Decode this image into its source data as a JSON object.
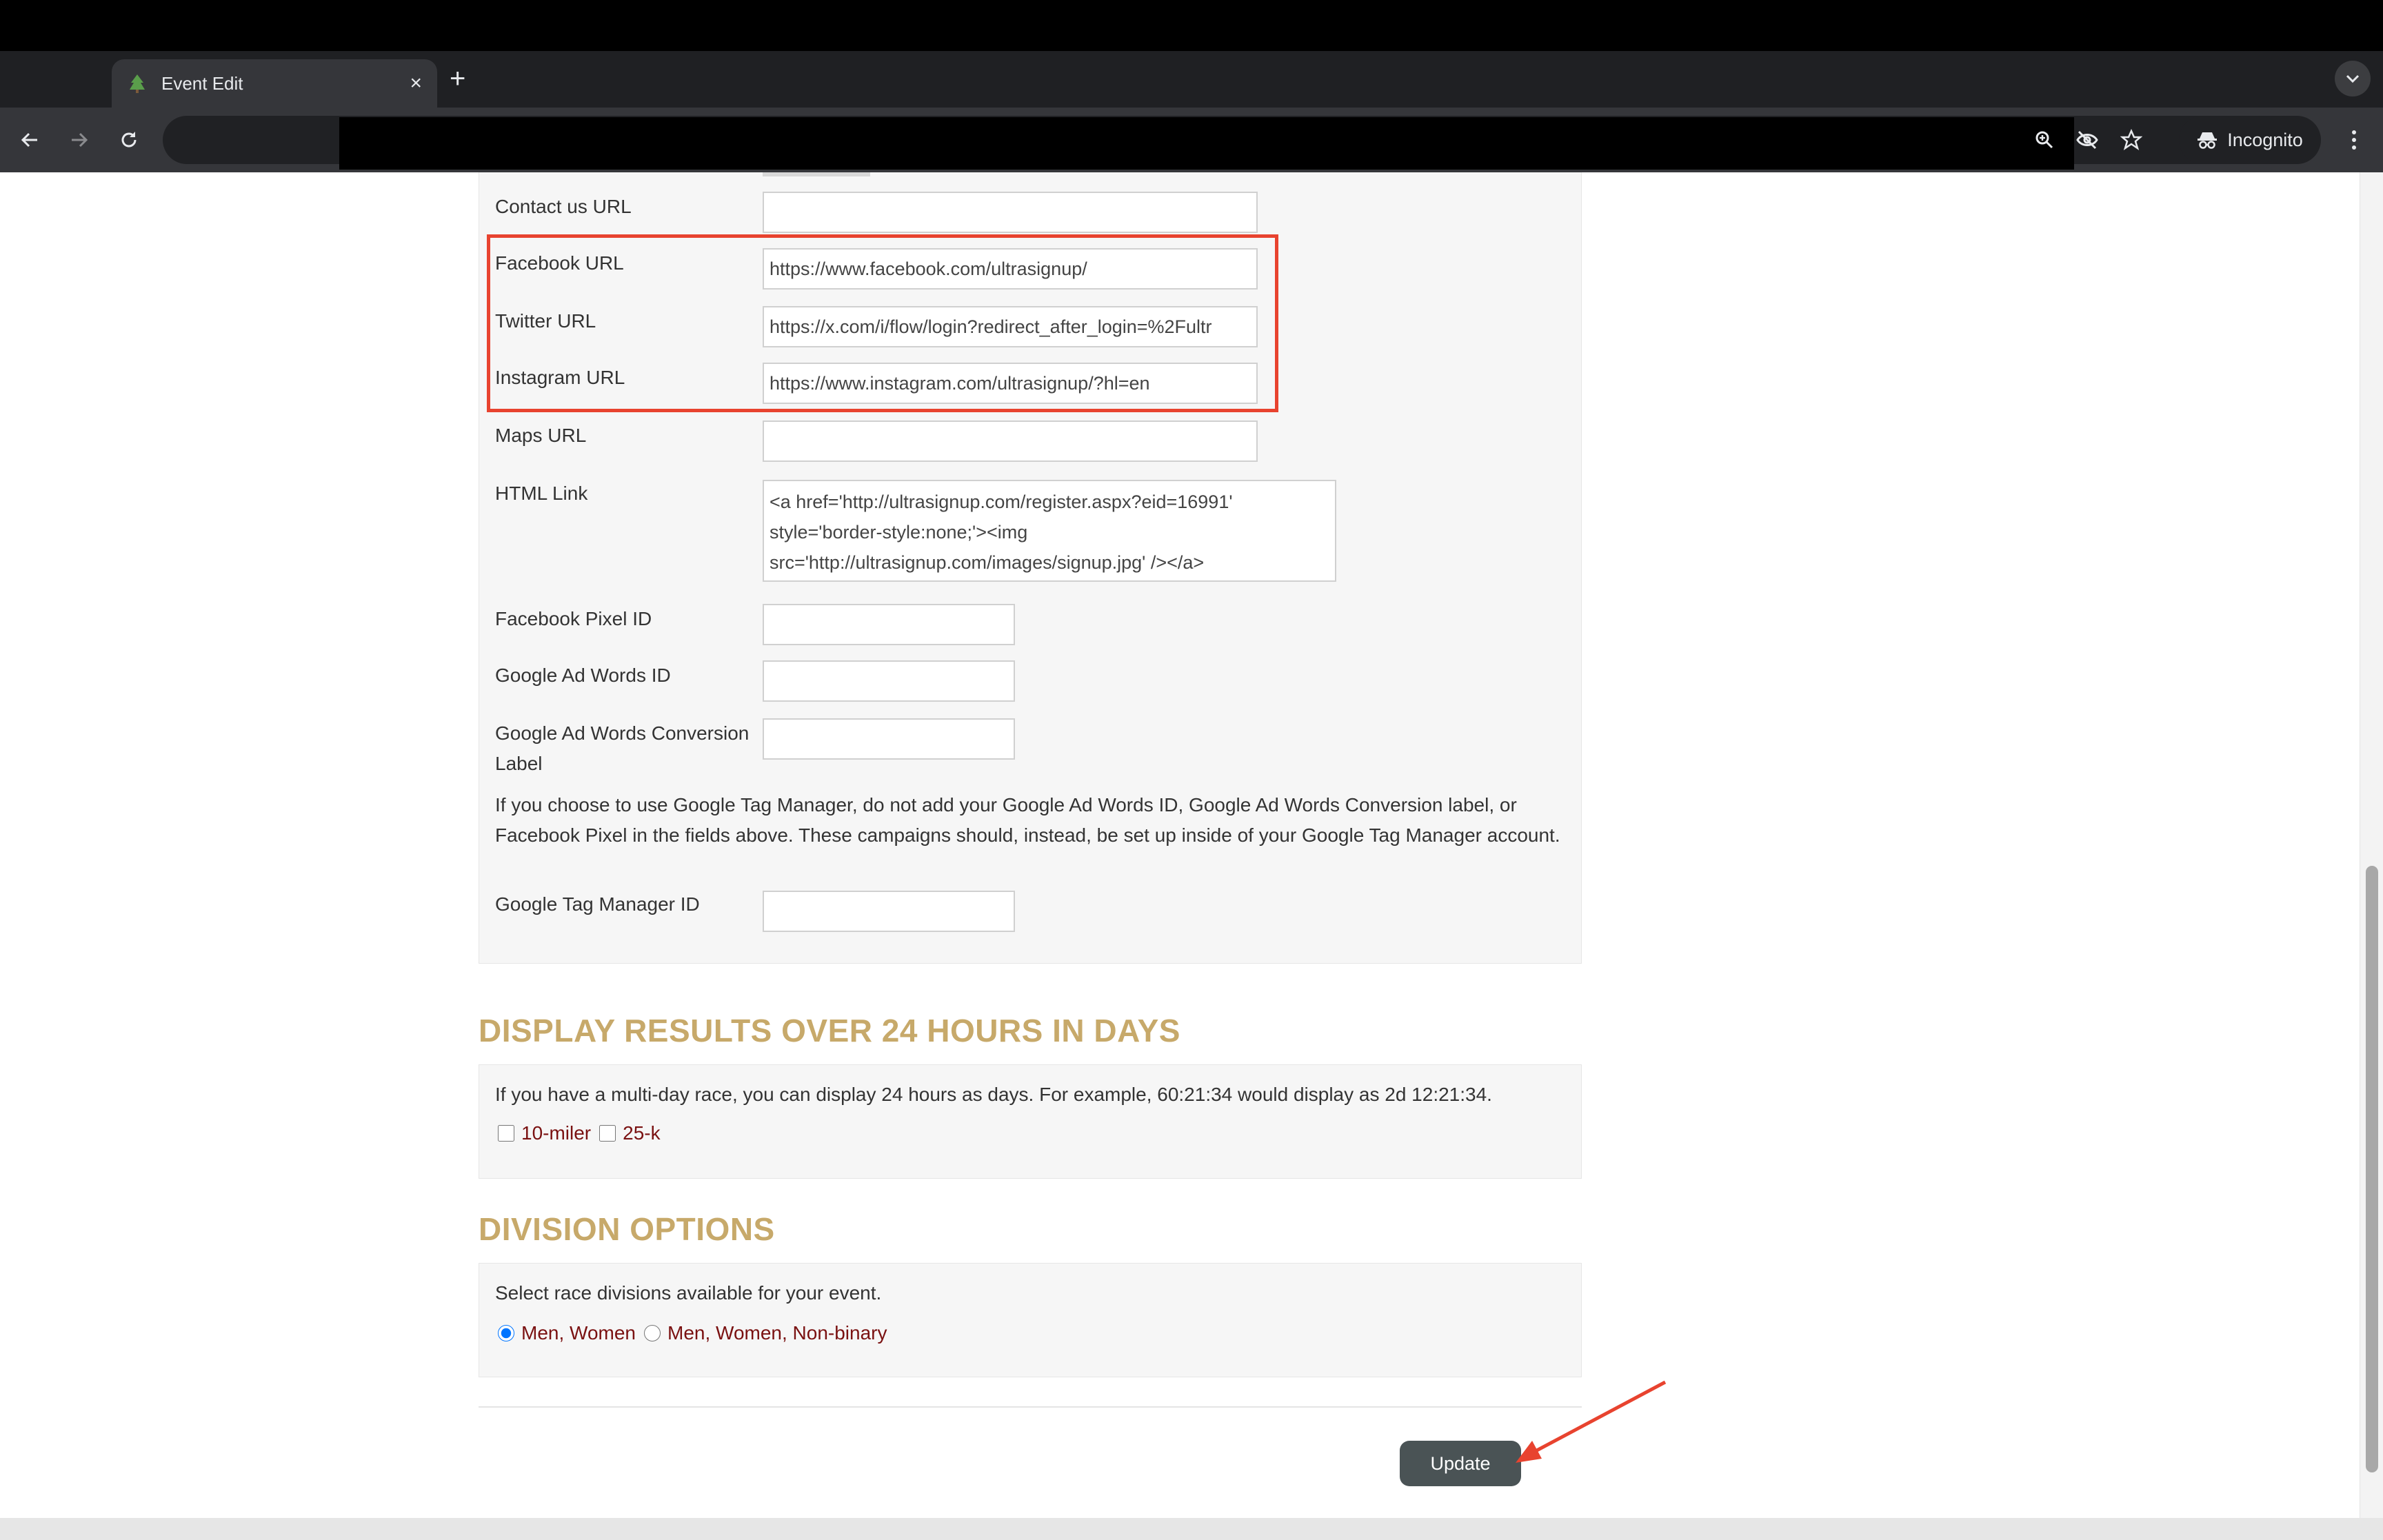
{
  "browser": {
    "tab_title": "Event Edit",
    "tab_close": "×",
    "new_tab": "+",
    "incognito_label": "Incognito"
  },
  "form": {
    "contact_label": "Contact us URL",
    "contact_value": "",
    "facebook_label": "Facebook URL",
    "facebook_value": "https://www.facebook.com/ultrasignup/",
    "twitter_label": "Twitter URL",
    "twitter_value": "https://x.com/i/flow/login?redirect_after_login=%2Fultr",
    "instagram_label": "Instagram URL",
    "instagram_value": "https://www.instagram.com/ultrasignup/?hl=en",
    "maps_label": "Maps URL",
    "maps_value": "",
    "html_link_label": "HTML Link",
    "html_link_value": "<a href='http://ultrasignup.com/register.aspx?eid=16991' style='border-style:none;'><img src='http://ultrasignup.com/images/signup.jpg' /></a>",
    "fb_pixel_label": "Facebook Pixel ID",
    "fb_pixel_value": "",
    "adwords_label": "Google Ad Words ID",
    "adwords_value": "",
    "conversion_label_line1": "Google Ad Words Conversion",
    "conversion_label_line2": "Label",
    "conversion_value": "",
    "gtm_note": "If you choose to use Google Tag Manager, do not add your Google Ad Words ID, Google Ad Words Conversion label, or Facebook Pixel in the fields above. These campaigns should, instead, be set up inside of your Google Tag Manager account.",
    "gtm_label": "Google Tag Manager ID",
    "gtm_value": ""
  },
  "display_results": {
    "title": "DISPLAY RESULTS OVER 24 HOURS IN DAYS",
    "description": "If you have a multi-day race, you can display 24 hours as days. For example, 60:21:34 would display as 2d 12:21:34.",
    "options": [
      {
        "label": "10-miler",
        "checked": false
      },
      {
        "label": "25-k",
        "checked": false
      }
    ]
  },
  "division_options": {
    "title": "DIVISION OPTIONS",
    "description": "Select race divisions available for your event.",
    "options": [
      {
        "label": "Men, Women",
        "selected": true
      },
      {
        "label": "Men, Women, Non-binary",
        "selected": false
      }
    ]
  },
  "actions": {
    "update_label": "Update"
  },
  "colors": {
    "section_title": "#c7a96a",
    "option_label": "#7a1111",
    "highlight_border": "#e8432f",
    "update_button": "#4a5355"
  }
}
